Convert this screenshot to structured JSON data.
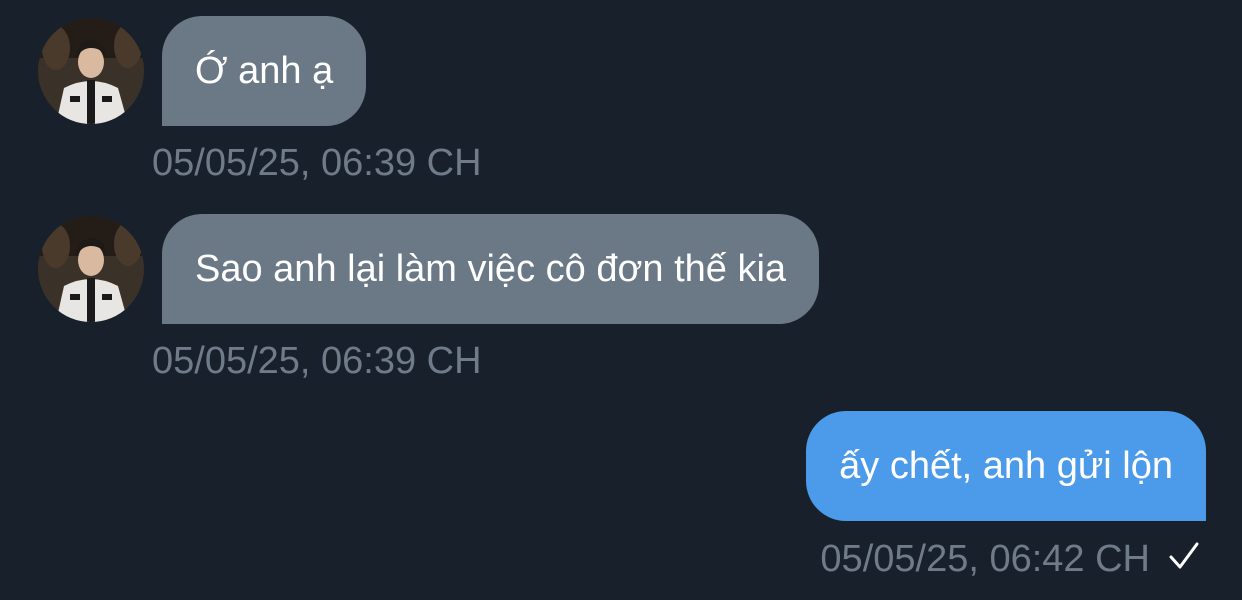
{
  "chat": {
    "messages": [
      {
        "direction": "incoming",
        "text": "Ớ anh ạ",
        "time": "05/05/25, 06:39 CH",
        "avatar": "contact-avatar"
      },
      {
        "direction": "incoming",
        "text": "Sao anh lại làm việc cô đơn thế kia",
        "time": "05/05/25, 06:39 CH",
        "avatar": "contact-avatar"
      },
      {
        "direction": "outgoing",
        "text": "ấy chết, anh gửi lộn",
        "time": "05/05/25, 06:42 CH",
        "status_icon": "checkmark-icon"
      }
    ]
  },
  "colors": {
    "background": "#18202b",
    "incoming_bubble": "#6b7886",
    "outgoing_bubble": "#4b9bea",
    "timestamp": "#6f7b89",
    "text": "#ffffff"
  }
}
